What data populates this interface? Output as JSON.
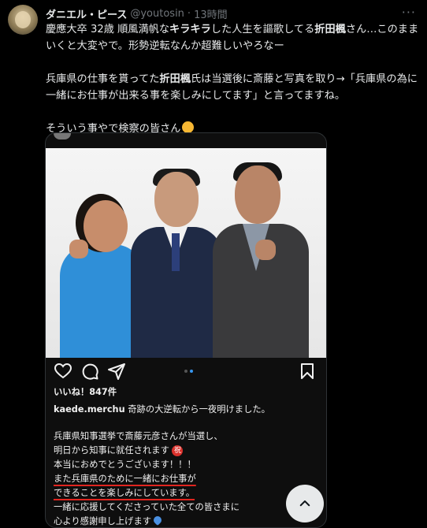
{
  "tweet": {
    "author_name": "ダニエル・ピース",
    "author_handle": "@youtosin",
    "separator": "·",
    "time": "13時間",
    "more_icon": "more-icon",
    "text_p1_a": "慶應大卒 32歳 順風満帆な",
    "text_p1_b": "キラキラ",
    "text_p1_c": "した人生を謳歌してる",
    "text_p1_d": "折田楓",
    "text_p1_e": "さん…このままいくと大変やで。形勢逆転なんか超難しいやろなー",
    "text_p2_a": "兵庫県の仕事を貰ってた",
    "text_p2_b": "折田楓",
    "text_p2_c": "氏は当選後に斎藤と写真を取り→「兵庫県の為に一緒にお仕事が出来る事を楽しみにしてます」と言ってますね。",
    "text_p3": "そういう事やで検察の皆さん"
  },
  "instagram": {
    "likes": "いいね！847件",
    "username": "kaede.merchu",
    "caption_first": "奇跡の大逆転から一夜明けました。",
    "line1": "兵庫県知事選挙で斎藤元彦さんが当選し、",
    "line2": "明日から知事に就任されます",
    "badge": "祝",
    "line3": "本当におめでとうございます！！！",
    "line4": "また兵庫県のために一緒にお仕事が",
    "line5": "できることを楽しみにしています。",
    "line6": "一緒に応援してくださっていた全ての皆さまに",
    "line7": "心より感謝申し上げます",
    "pager_count": 2,
    "pager_active": 1
  },
  "icons": {
    "like": "heart-icon",
    "comment": "comment-icon",
    "share": "share-icon",
    "save": "bookmark-icon",
    "scroll": "chevron-up-icon"
  },
  "colors": {
    "background": "#000000",
    "text": "#e7e9ea",
    "muted": "#71767b",
    "underline": "#e0251f",
    "accent": "#3797f0"
  }
}
